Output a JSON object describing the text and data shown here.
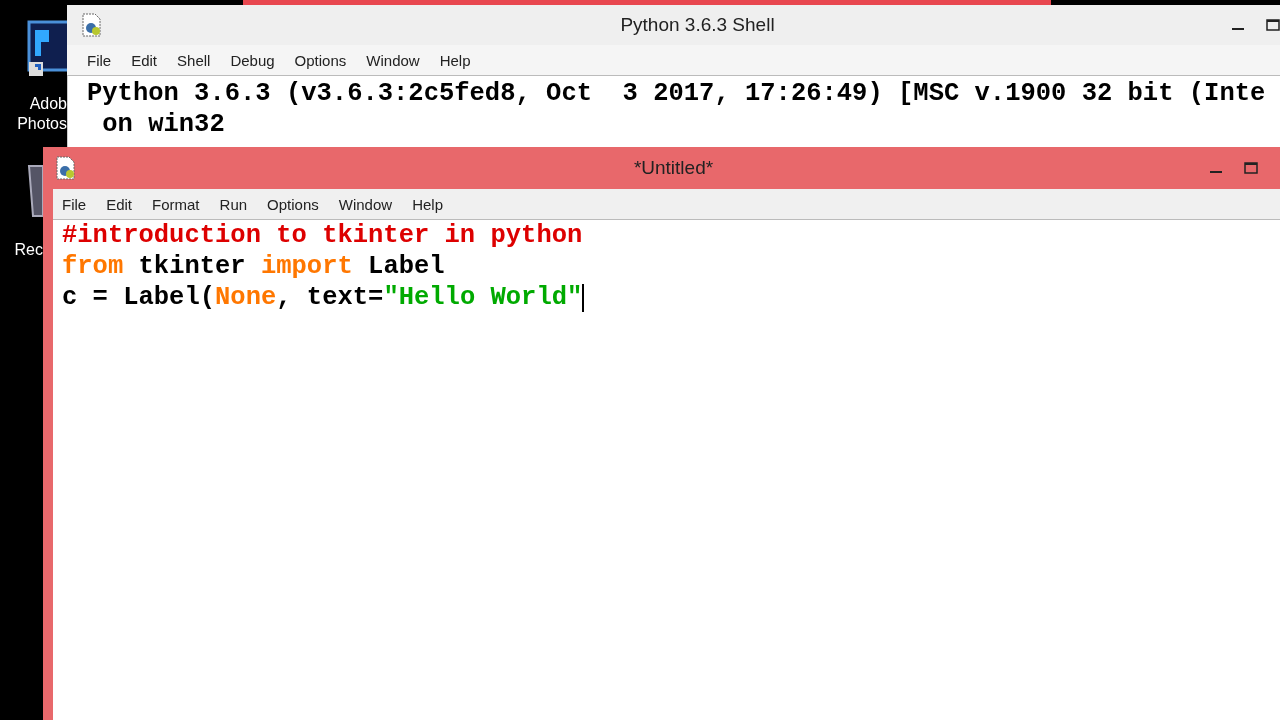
{
  "desktop_icons": [
    {
      "kind": "photoshop",
      "label_lines": [
        "Adob",
        "Photos"
      ]
    },
    {
      "kind": "recycle-bin",
      "label_lines": [
        "Rec"
      ]
    }
  ],
  "shell_window": {
    "title": "Python 3.6.3 Shell",
    "menu": [
      "File",
      "Edit",
      "Shell",
      "Debug",
      "Options",
      "Window",
      "Help"
    ],
    "output_lines": [
      "Python 3.6.3 (v3.6.3:2c5fed8, Oct  3 2017, 17:26:49) [MSC v.1900 32 bit (Inte",
      " on win32"
    ]
  },
  "editor_window": {
    "title": "*Untitled*",
    "menu": [
      "File",
      "Edit",
      "Format",
      "Run",
      "Options",
      "Window",
      "Help"
    ],
    "code_lines": [
      [
        {
          "kind": "comment",
          "text": "#introduction to tkinter in python"
        }
      ],
      [
        {
          "kind": "keyword",
          "text": "from"
        },
        {
          "kind": "plain",
          "text": " tkinter "
        },
        {
          "kind": "keyword",
          "text": "import"
        },
        {
          "kind": "plain",
          "text": " Label"
        }
      ],
      [
        {
          "kind": "plain",
          "text": "c = Label("
        },
        {
          "kind": "keyword",
          "text": "None"
        },
        {
          "kind": "plain",
          "text": ", text="
        },
        {
          "kind": "string",
          "text": "\"Hello World\""
        }
      ]
    ]
  }
}
